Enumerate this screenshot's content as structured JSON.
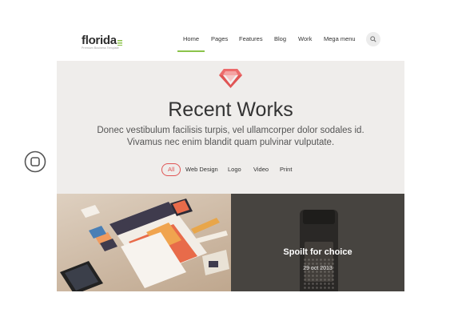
{
  "brand": {
    "name": "florida",
    "tagline": "Premium Business Template",
    "accent": "#8bc34a"
  },
  "nav": {
    "items": [
      "Home",
      "Pages",
      "Features",
      "Blog",
      "Work",
      "Mega menu"
    ],
    "active": "Home",
    "search_icon": "search-icon"
  },
  "hero": {
    "icon": "diamond-icon",
    "icon_color": "#e05555",
    "title": "Recent Works",
    "subtitle_line1": "Donec vestibulum facilisis turpis, vel ullamcorper dolor sodales id.",
    "subtitle_line2": "Vivamus nec enim blandit quam pulvinar vulputate.",
    "background": "#efedeb"
  },
  "filters": {
    "items": [
      "All",
      "Web Design",
      "Logo",
      "Video",
      "Print"
    ],
    "active": "All",
    "active_color": "#e05555"
  },
  "gallery": {
    "tiles": [
      {
        "kind": "image",
        "subject": "stationery branding mockup"
      },
      {
        "kind": "hover",
        "title": "Spoilt for choice",
        "date": "29 oct 2013",
        "subject": "bottle photo with dark overlay"
      }
    ]
  },
  "side_control": {
    "icon": "home-button-icon"
  }
}
